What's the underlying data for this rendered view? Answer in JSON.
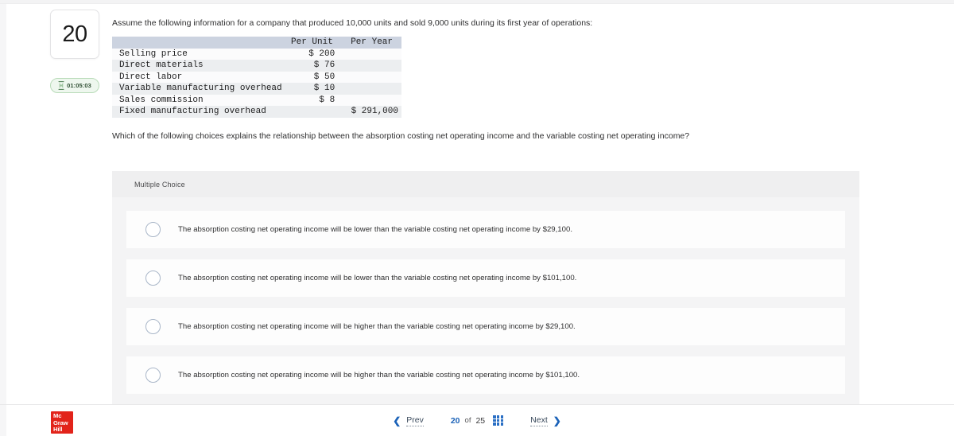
{
  "sidebar": {
    "question_number": "20",
    "timer": {
      "icon": "hourglass-icon",
      "value": "01:05:03"
    }
  },
  "main": {
    "intro": "Assume the following information for a company that produced 10,000 units and sold 9,000 units during its first year of operations:",
    "question": "Which of the following choices explains the relationship between the absorption costing net operating income and the variable costing net operating income?",
    "table": {
      "headers": [
        "",
        "Per Unit",
        "Per Year"
      ],
      "rows": [
        {
          "label": "Selling price",
          "per_unit": "$ 200",
          "per_year": ""
        },
        {
          "label": "Direct materials",
          "per_unit": "$ 76",
          "per_year": ""
        },
        {
          "label": "Direct labor",
          "per_unit": "$ 50",
          "per_year": ""
        },
        {
          "label": "Variable manufacturing overhead",
          "per_unit": "$ 10",
          "per_year": ""
        },
        {
          "label": "Sales commission",
          "per_unit": "$ 8",
          "per_year": ""
        },
        {
          "label": "Fixed manufacturing overhead",
          "per_unit": "",
          "per_year": "$ 291,000"
        }
      ]
    }
  },
  "answer": {
    "type_label": "Multiple Choice",
    "options": [
      {
        "text": "The absorption costing net operating income will be lower than the variable costing net operating income by $29,100.",
        "selected": false
      },
      {
        "text": "The absorption costing net operating income will be lower than the variable costing net operating income by $101,100.",
        "selected": false
      },
      {
        "text": "The absorption costing net operating income will be higher than the variable costing net operating income by $29,100.",
        "selected": false
      },
      {
        "text": "The absorption costing net operating income will be higher than the variable costing net operating income by $101,100.",
        "selected": false
      }
    ]
  },
  "footer": {
    "logo": {
      "line1": "Mc",
      "line2": "Graw",
      "line3": "Hill",
      "color": "#e2231a"
    },
    "prev_label": "Prev",
    "next_label": "Next",
    "current_page": "20",
    "of_label": "of",
    "total_pages": "25",
    "grid_icon": "grid-menu-icon",
    "prev_icon": "chevron-left-icon",
    "next_icon": "chevron-right-icon"
  }
}
